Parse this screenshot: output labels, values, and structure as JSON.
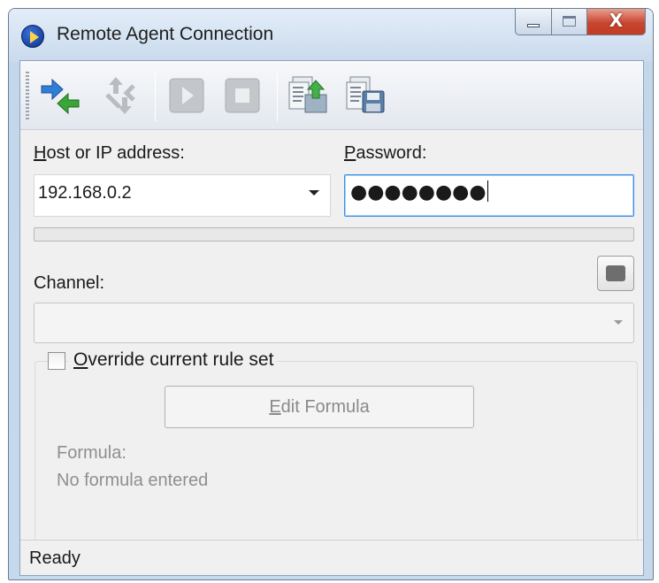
{
  "window": {
    "title": "Remote Agent Connection",
    "close_glyph": "X"
  },
  "toolbar": {
    "buttons": [
      {
        "name": "connect-icon",
        "enabled": true
      },
      {
        "name": "disconnect-icon",
        "enabled": false
      },
      {
        "name": "play-icon",
        "enabled": false
      },
      {
        "name": "stop-icon",
        "enabled": false
      },
      {
        "name": "import-icon",
        "enabled": true
      },
      {
        "name": "save-icon",
        "enabled": true
      }
    ]
  },
  "form": {
    "host_label_prefix": "H",
    "host_label_rest": "ost or IP address:",
    "host_value": "192.168.0.2",
    "password_label_prefix": "P",
    "password_label_rest": "assword:",
    "password_value": "●●●●●●●●",
    "progress": 0,
    "channel_label": "Channel:",
    "channel_value": "",
    "override_prefix": "O",
    "override_rest": "verride current rule set",
    "override_checked": false,
    "edit_formula_prefix": "E",
    "edit_formula_rest": "dit Formula",
    "formula_label": "Formula:",
    "formula_value": "No formula entered"
  },
  "status": {
    "text": "Ready"
  },
  "colors": {
    "accent": "#3d8ee6",
    "connect_green": "#3aa63a",
    "connect_blue": "#2f7fd6"
  }
}
